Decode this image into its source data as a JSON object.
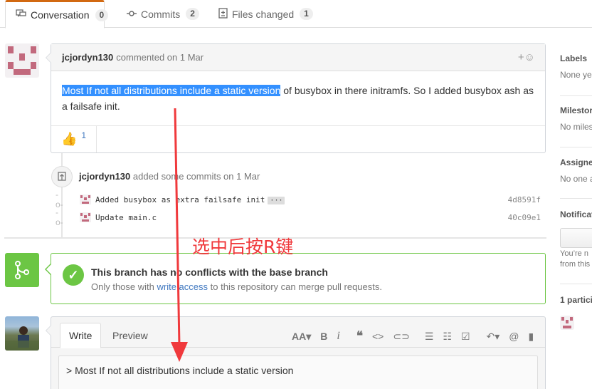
{
  "tabs": [
    {
      "label": "Conversation",
      "count": "0",
      "icon": "comment-discussion-icon"
    },
    {
      "label": "Commits",
      "count": "2",
      "icon": "git-commit-icon"
    },
    {
      "label": "Files changed",
      "count": "1",
      "icon": "diff-icon"
    }
  ],
  "comment": {
    "author": "jcjordyn130",
    "action": "commented on 1 Mar",
    "selected_text": "Most If not all distributions include a static version",
    "body_rest": " of busybox in there initramfs. So I added busybox ash as a failsafe init.",
    "reaction_emoji": "👍",
    "reaction_count": "1"
  },
  "event": {
    "author": "jcjordyn130",
    "action": "added some commits on 1 Mar"
  },
  "commits": [
    {
      "message": "Added busybox as extra failsafe init",
      "has_ellipsis": true,
      "sha": "4d8591f"
    },
    {
      "message": "Update main.c",
      "has_ellipsis": false,
      "sha": "40c09e1"
    }
  ],
  "merge": {
    "title": "This branch has no conflicts with the base branch",
    "sub_before": "Only those with ",
    "sub_link": "write access",
    "sub_after": " to this repository can merge pull requests."
  },
  "editor": {
    "tab_write": "Write",
    "tab_preview": "Preview",
    "textarea_value": "> Most If not all distributions include a static version"
  },
  "sidebar": {
    "labels_h": "Labels",
    "labels_v": "None ye",
    "milestone_h": "Milestor",
    "milestone_v": "No miles",
    "assignees_h": "Assigne",
    "assignees_v": "No one a",
    "notif_h": "Notificat",
    "notif_v1": "You’re n",
    "notif_v2": "from this",
    "participants_h": "1 partici"
  },
  "annotation": "选中后按R键",
  "colors": {
    "accent_tab": "#d26911",
    "selection": "#3390ff",
    "merge_green": "#6cc644",
    "link": "#4078c0",
    "annotation_red": "#f0393c",
    "identicon": "#c2697d"
  }
}
